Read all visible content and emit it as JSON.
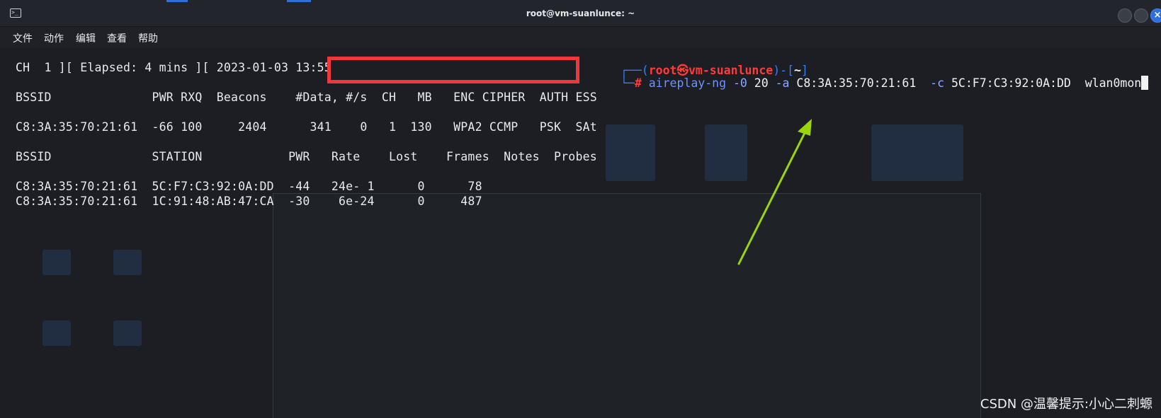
{
  "window": {
    "title": "root@vm-suanlunce: ~"
  },
  "menu": [
    "文件",
    "动作",
    "编辑",
    "查看",
    "帮助"
  ],
  "airodump": {
    "status_line": "CH  1 ][ Elapsed: 4 mins ][ 2023-01-03 13:55",
    "ap_header": "BSSID              PWR RXQ  Beacons    #Data, #/s  CH   MB   ENC CIPHER  AUTH ESS",
    "ap_rows": [
      "C8:3A:35:70:21:61  -66 100     2404      341    0   1  130   WPA2 CCMP   PSK  SAt"
    ],
    "station_header": "BSSID              STATION            PWR   Rate    Lost    Frames  Notes  Probes",
    "station_rows": [
      "C8:3A:35:70:21:61  5C:F7:C3:92:0A:DD  -44   24e- 1      0      78",
      "C8:3A:35:70:21:61  1C:91:48:AB:47:CA  -30    6e-24      0     487"
    ]
  },
  "prompt": {
    "corner_top": "┌──(",
    "user": "root",
    "at_symbol": "㉿",
    "host": "vm-suanlunce",
    "close_paren": ")-[",
    "path": "~",
    "close_bracket": "]",
    "corner_bottom": "└─",
    "hash": "#",
    "command": "aireplay-ng",
    "args": [
      {
        "opt": "-0",
        "val": "20"
      },
      {
        "opt": "-a",
        "val": "C8:3A:35:70:21:61"
      },
      {
        "opt": "-c",
        "val": "5C:F7:C3:92:0A:DD"
      }
    ],
    "iface": "wlan0mon"
  },
  "watermark": "CSDN @温馨提示:小心二刺螈",
  "colors": {
    "redbox": "#f0383c",
    "arrow": "#9bd40a",
    "prompt_blue": "#3d7cf0",
    "prompt_red": "#ff3b3b"
  }
}
